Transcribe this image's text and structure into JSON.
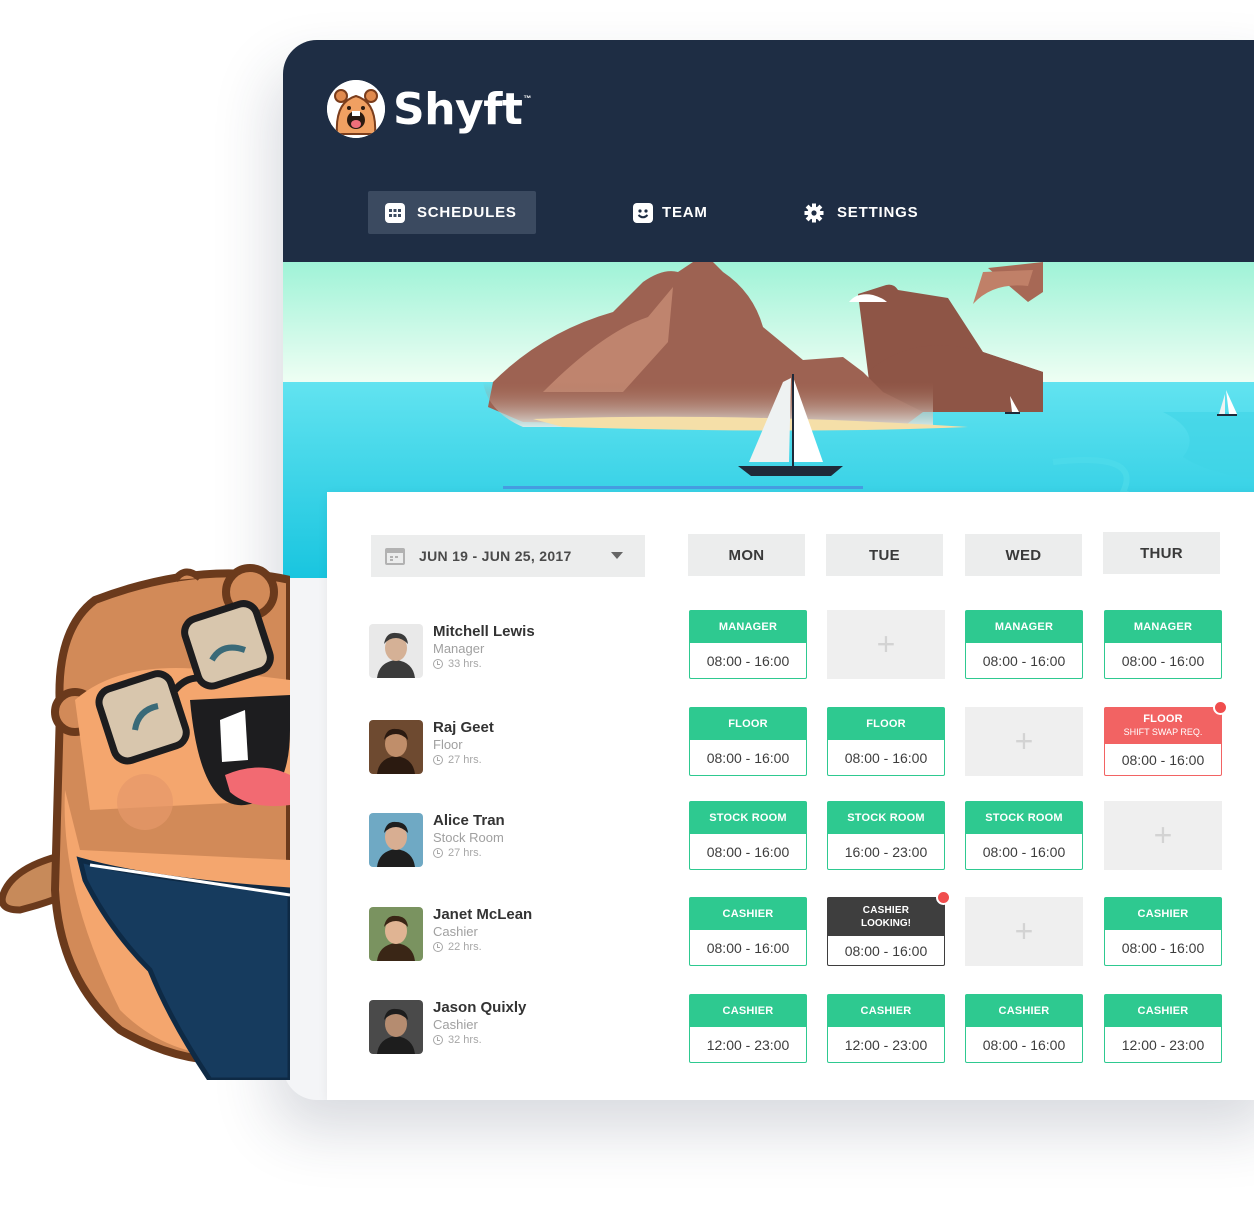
{
  "brand": {
    "name": "Shyft",
    "tm": "™"
  },
  "nav": [
    {
      "label": "SCHEDULES",
      "icon": "calendar-grid-icon",
      "active": true
    },
    {
      "label": "TEAM",
      "icon": "smiley-face-icon",
      "active": false
    },
    {
      "label": "SETTINGS",
      "icon": "gear-icon",
      "active": false
    }
  ],
  "week": {
    "label": "JUN 19 - JUN 25, 2017"
  },
  "days": [
    "MON",
    "TUE",
    "WED",
    "THUR"
  ],
  "employees": [
    {
      "name": "Mitchell Lewis",
      "role": "Manager",
      "hours": "33 hrs."
    },
    {
      "name": "Raj Geet",
      "role": "Floor",
      "hours": "27 hrs."
    },
    {
      "name": "Alice Tran",
      "role": "Stock Room",
      "hours": "27 hrs."
    },
    {
      "name": "Janet McLean",
      "role": "Cashier",
      "hours": "22 hrs."
    },
    {
      "name": "Jason Quixly",
      "role": "Cashier",
      "hours": "32 hrs."
    }
  ],
  "shifts": [
    [
      {
        "title": "MANAGER",
        "time": "08:00 - 16:00"
      },
      {
        "empty": true
      },
      {
        "title": "MANAGER",
        "time": "08:00 - 16:00"
      },
      {
        "title": "MANAGER",
        "time": "08:00 - 16:00"
      }
    ],
    [
      {
        "title": "FLOOR",
        "time": "08:00 - 16:00"
      },
      {
        "title": "FLOOR",
        "time": "08:00 - 16:00"
      },
      {
        "empty": true
      },
      {
        "title": "FLOOR",
        "sub": "SHIFT SWAP REQ.",
        "time": "08:00 - 16:00",
        "status": "swap"
      }
    ],
    [
      {
        "title": "STOCK ROOM",
        "time": "08:00 - 16:00"
      },
      {
        "title": "STOCK ROOM",
        "time": "16:00 - 23:00"
      },
      {
        "title": "STOCK ROOM",
        "time": "08:00 - 16:00"
      },
      {
        "empty": true
      }
    ],
    [
      {
        "title": "CASHIER",
        "time": "08:00 - 16:00"
      },
      {
        "title": "CASHIER",
        "sub": "LOOKING!",
        "time": "08:00 - 16:00",
        "status": "looking"
      },
      {
        "empty": true
      },
      {
        "title": "CASHIER",
        "time": "08:00 - 16:00"
      }
    ],
    [
      {
        "title": "CASHIER",
        "time": "12:00 - 23:00"
      },
      {
        "title": "CASHIER",
        "time": "12:00 - 23:00"
      },
      {
        "title": "CASHIER",
        "time": "08:00 - 16:00"
      },
      {
        "title": "CASHIER",
        "time": "12:00 - 23:00"
      }
    ]
  ],
  "add_symbol": "+",
  "colors": {
    "header": "#1e2d44",
    "shift_green": "#2ec990",
    "swap_red": "#f26363",
    "looking_dark": "#3e3e3e"
  }
}
